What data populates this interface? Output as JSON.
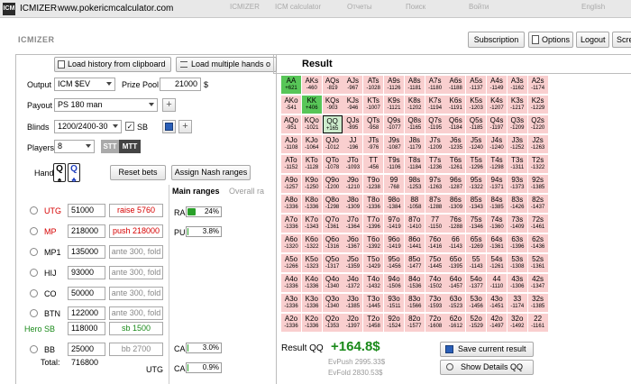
{
  "window": {
    "app": "ICMIZER",
    "url": "www.pokericmcalculator.com"
  },
  "bg_tabs": [
    "ICMIZER",
    "ICM calculator",
    "Отчеты",
    "Поиск",
    "Войти",
    "English"
  ],
  "brand": "ICMIZER",
  "nav": {
    "subscription": "Subscription",
    "options": "Options",
    "logout": "Logout",
    "screen": "Scre"
  },
  "load_history": "Load history from clipboard",
  "load_multiple": "Load multiple hands o",
  "output": {
    "label": "Output",
    "value": "ICM $EV"
  },
  "prize_pool": {
    "label": "Prize Pool",
    "value": "21000",
    "unit": "$"
  },
  "payout": {
    "label": "Payout",
    "value": "PS 180 man"
  },
  "blinds": {
    "label": "Blinds",
    "value": "1200/2400-30",
    "sb_label": "SB"
  },
  "players": {
    "label": "Players",
    "value": "8",
    "mode_off": "STT",
    "mode_on": "MTT"
  },
  "hand": {
    "label": "Hand",
    "card1": "Q",
    "card2": "Q"
  },
  "reset_bets": "Reset bets",
  "assign_nash": "Assign Nash ranges",
  "range_tabs": {
    "main": "Main ranges",
    "overall": "Overall ra"
  },
  "meters": {
    "ra": {
      "label": "RA",
      "value": "24%",
      "fill": 0.24
    },
    "pu": {
      "label": "PU",
      "value": "3.8%",
      "fill": 0.038
    },
    "ca1": {
      "label": "CA",
      "value": "3.0%",
      "fill": 0.03
    },
    "ca2": {
      "label": "CA",
      "value": "0.9%",
      "fill": 0.009
    }
  },
  "positions": [
    {
      "name": "UTG",
      "stack": "51000",
      "action": "raise 5760",
      "color": "red"
    },
    {
      "name": "MP",
      "stack": "218000",
      "action": "push 218000",
      "color": "red"
    },
    {
      "name": "MP1",
      "stack": "135000",
      "action": "ante 300, fold",
      "color": "gray"
    },
    {
      "name": "HIJ",
      "stack": "93000",
      "action": "ante 300, fold",
      "color": "gray"
    },
    {
      "name": "CO",
      "stack": "50000",
      "action": "ante 300, fold",
      "color": "gray"
    },
    {
      "name": "BTN",
      "stack": "122000",
      "action": "ante 300, fold",
      "color": "gray"
    },
    {
      "name": "Hero  SB",
      "stack": "118000",
      "action": "sb 1500",
      "color": "green"
    },
    {
      "name": "BB",
      "stack": "25000",
      "action": "bb 2700",
      "color": "gray"
    }
  ],
  "total": {
    "label": "Total:",
    "value": "716800"
  },
  "utg_tag": "UTG",
  "result": {
    "title": "Result",
    "label": "Result QQ",
    "value": "+164.8$",
    "evpush": "EvPush 2995.33$",
    "evfold": "EvFold 2830.53$",
    "save": "Save current result",
    "show": "Show Details QQ"
  },
  "grid": [
    [
      [
        "AA",
        "+621"
      ],
      [
        "AKs",
        "-460"
      ],
      [
        "AQs",
        "-819"
      ],
      [
        "AJs",
        "-967"
      ],
      [
        "ATs",
        "-1028"
      ],
      [
        "A9s",
        "-1126"
      ],
      [
        "A8s",
        "-1181"
      ],
      [
        "A7s",
        "-1180"
      ],
      [
        "A6s",
        "-1188"
      ],
      [
        "A5s",
        "-1137"
      ],
      [
        "A4s",
        "-1149"
      ],
      [
        "A3s",
        "-1162"
      ],
      [
        "A2s",
        "-1174"
      ]
    ],
    [
      [
        "AKo",
        "-541"
      ],
      [
        "KK",
        "+406"
      ],
      [
        "KQs",
        "-903"
      ],
      [
        "KJs",
        "-946"
      ],
      [
        "KTs",
        "-1007"
      ],
      [
        "K9s",
        "-1121"
      ],
      [
        "K8s",
        "-1202"
      ],
      [
        "K7s",
        "-1194"
      ],
      [
        "K6s",
        "-1191"
      ],
      [
        "K5s",
        "-1203"
      ],
      [
        "K4s",
        "-1207"
      ],
      [
        "K3s",
        "-1217"
      ],
      [
        "K2s",
        "-1229"
      ]
    ],
    [
      [
        "AQo",
        "-951"
      ],
      [
        "KQo",
        "-1021"
      ],
      [
        "QQ",
        "+165"
      ],
      [
        "QJs",
        "-895"
      ],
      [
        "QTs",
        "-958"
      ],
      [
        "Q9s",
        "-1077"
      ],
      [
        "Q8s",
        "-1165"
      ],
      [
        "Q7s",
        "-1195"
      ],
      [
        "Q6s",
        "-1184"
      ],
      [
        "Q5s",
        "-1185"
      ],
      [
        "Q4s",
        "-1197"
      ],
      [
        "Q3s",
        "-1209"
      ],
      [
        "Q2s",
        "-1220"
      ]
    ],
    [
      [
        "AJo",
        "-1108"
      ],
      [
        "KJo",
        "-1064"
      ],
      [
        "QJo",
        "-1012"
      ],
      [
        "JJ",
        "-196"
      ],
      [
        "JTs",
        "-976"
      ],
      [
        "J9s",
        "-1087"
      ],
      [
        "J8s",
        "-1179"
      ],
      [
        "J7s",
        "-1209"
      ],
      [
        "J6s",
        "-1235"
      ],
      [
        "J5s",
        "-1240"
      ],
      [
        "J4s",
        "-1240"
      ],
      [
        "J3s",
        "-1252"
      ],
      [
        "J2s",
        "-1263"
      ]
    ],
    [
      [
        "ATo",
        "-1152"
      ],
      [
        "KTo",
        "-1128"
      ],
      [
        "QTo",
        "-1078"
      ],
      [
        "JTo",
        "-1093"
      ],
      [
        "TT",
        "-456"
      ],
      [
        "T9s",
        "-1106"
      ],
      [
        "T8s",
        "-1184"
      ],
      [
        "T7s",
        "-1236"
      ],
      [
        "T6s",
        "-1261"
      ],
      [
        "T5s",
        "-1296"
      ],
      [
        "T4s",
        "-1298"
      ],
      [
        "T3s",
        "-1311"
      ],
      [
        "T2s",
        "-1322"
      ]
    ],
    [
      [
        "A9o",
        "-1257"
      ],
      [
        "K9o",
        "-1250"
      ],
      [
        "Q9o",
        "-1200"
      ],
      [
        "J9o",
        "-1210"
      ],
      [
        "T9o",
        "-1238"
      ],
      [
        "99",
        "-768"
      ],
      [
        "98s",
        "-1253"
      ],
      [
        "97s",
        "-1263"
      ],
      [
        "96s",
        "-1287"
      ],
      [
        "95s",
        "-1322"
      ],
      [
        "94s",
        "-1371"
      ],
      [
        "93s",
        "-1373"
      ],
      [
        "92s",
        "-1385"
      ]
    ],
    [
      [
        "A8o",
        "-1336"
      ],
      [
        "K8o",
        "-1336"
      ],
      [
        "Q8o",
        "-1298"
      ],
      [
        "J8o",
        "-1309"
      ],
      [
        "T8o",
        "-1336"
      ],
      [
        "98o",
        "-1384"
      ],
      [
        "88",
        "-1058"
      ],
      [
        "87s",
        "-1288"
      ],
      [
        "86s",
        "-1309"
      ],
      [
        "85s",
        "-1343"
      ],
      [
        "84s",
        "-1385"
      ],
      [
        "83s",
        "-1426"
      ],
      [
        "82s",
        "-1437"
      ]
    ],
    [
      [
        "A7o",
        "-1336"
      ],
      [
        "K7o",
        "-1343"
      ],
      [
        "Q7o",
        "-1361"
      ],
      [
        "J7o",
        "-1364"
      ],
      [
        "T7o",
        "-1396"
      ],
      [
        "97o",
        "-1419"
      ],
      [
        "87o",
        "-1410"
      ],
      [
        "77",
        "-1150"
      ],
      [
        "76s",
        "-1288"
      ],
      [
        "75s",
        "-1346"
      ],
      [
        "74s",
        "-1360"
      ],
      [
        "73s",
        "-1409"
      ],
      [
        "72s",
        "-1461"
      ]
    ],
    [
      [
        "A6o",
        "-1320"
      ],
      [
        "K6o",
        "-1322"
      ],
      [
        "Q6o",
        "-1316"
      ],
      [
        "J6o",
        "-1367"
      ],
      [
        "T6o",
        "-1392"
      ],
      [
        "96o",
        "-1419"
      ],
      [
        "86o",
        "-1441"
      ],
      [
        "76o",
        "-1416"
      ],
      [
        "66",
        "-1143"
      ],
      [
        "65s",
        "-1269"
      ],
      [
        "64s",
        "-1361"
      ],
      [
        "63s",
        "-1396"
      ],
      [
        "62s",
        "-1436"
      ]
    ],
    [
      [
        "A5o",
        "-1266"
      ],
      [
        "K5o",
        "-1323"
      ],
      [
        "Q5o",
        "-1317"
      ],
      [
        "J5o",
        "-1359"
      ],
      [
        "T5o",
        "-1429"
      ],
      [
        "95o",
        "-1456"
      ],
      [
        "85o",
        "-1477"
      ],
      [
        "75o",
        "-1445"
      ],
      [
        "65o",
        "-1395"
      ],
      [
        "55",
        "-1143"
      ],
      [
        "54s",
        "-1261"
      ],
      [
        "53s",
        "-1308"
      ],
      [
        "52s",
        "-1361"
      ]
    ],
    [
      [
        "A4o",
        "-1336"
      ],
      [
        "K4o",
        "-1336"
      ],
      [
        "Q4o",
        "-1340"
      ],
      [
        "J4o",
        "-1372"
      ],
      [
        "T4o",
        "-1432"
      ],
      [
        "94o",
        "-1506"
      ],
      [
        "84o",
        "-1536"
      ],
      [
        "74o",
        "-1502"
      ],
      [
        "64o",
        "-1457"
      ],
      [
        "54o",
        "-1377"
      ],
      [
        "44",
        "-1110"
      ],
      [
        "43s",
        "-1306"
      ],
      [
        "42s",
        "-1347"
      ]
    ],
    [
      [
        "A3o",
        "-1336"
      ],
      [
        "K3o",
        "-1336"
      ],
      [
        "Q3o",
        "-1340"
      ],
      [
        "J3o",
        "-1385"
      ],
      [
        "T3o",
        "-1445"
      ],
      [
        "93o",
        "-1511"
      ],
      [
        "83o",
        "-1566"
      ],
      [
        "73o",
        "-1593"
      ],
      [
        "63o",
        "-1523"
      ],
      [
        "53o",
        "-1456"
      ],
      [
        "43o",
        "-1451"
      ],
      [
        "33",
        "-1174"
      ],
      [
        "32s",
        "-1385"
      ]
    ],
    [
      [
        "A2o",
        "-1336"
      ],
      [
        "K2o",
        "-1336"
      ],
      [
        "Q2o",
        "-1353"
      ],
      [
        "J2o",
        "-1397"
      ],
      [
        "T2o",
        "-1458"
      ],
      [
        "92o",
        "-1524"
      ],
      [
        "82o",
        "-1577"
      ],
      [
        "72o",
        "-1608"
      ],
      [
        "62o",
        "-1612"
      ],
      [
        "52o",
        "-1529"
      ],
      [
        "42o",
        "-1497"
      ],
      [
        "32o",
        "-1492"
      ],
      [
        "22",
        "-1161"
      ]
    ]
  ],
  "colors": {
    "green": "#58c658",
    "light_green": "#cdeccd",
    "pink": "#f9cfcf",
    "red": "#d60000",
    "result_green": "#1a8a1a"
  }
}
